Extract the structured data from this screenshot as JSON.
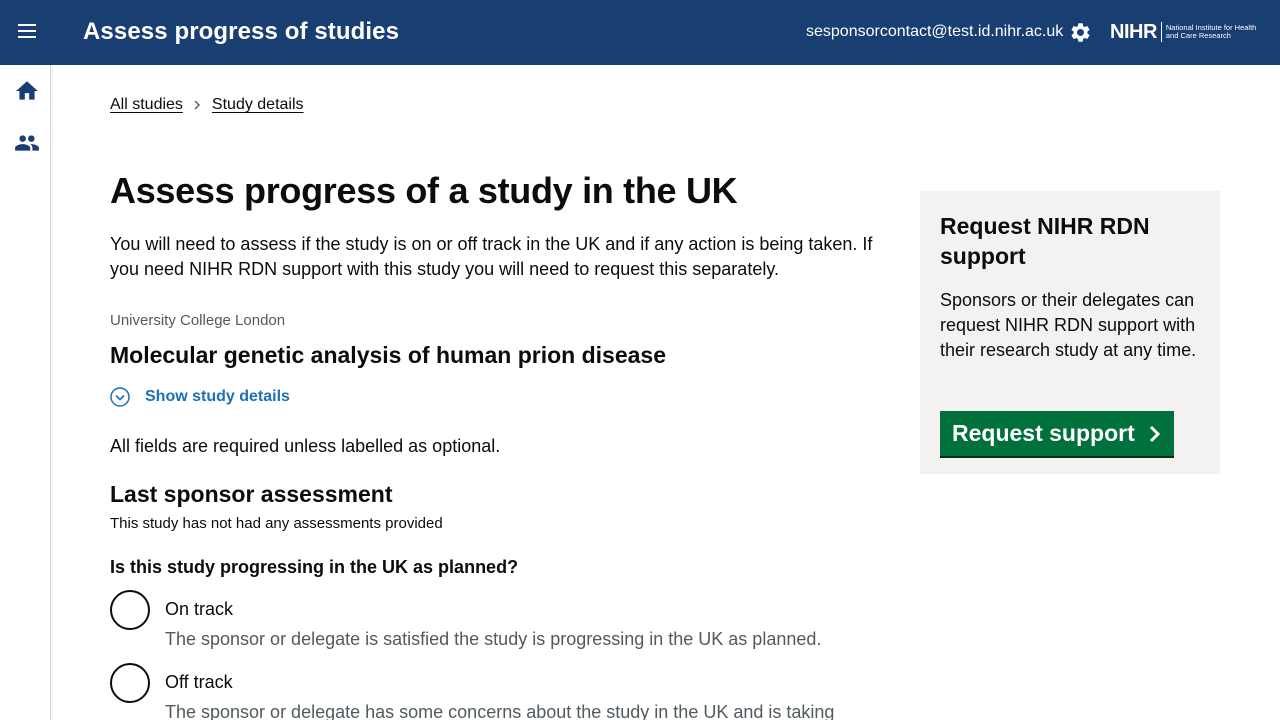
{
  "header": {
    "app_title": "Assess progress of studies",
    "user_email": "sesponsorcontact@test.id.nihr.ac.uk",
    "logo_mark": "NIHR",
    "logo_text": "National Institute for Health and Care Research",
    "menu_icon": "hamburger-icon",
    "settings_icon": "gear-icon",
    "brand_color": "#193e72"
  },
  "sidenav": {
    "items": [
      {
        "icon": "home-icon"
      },
      {
        "icon": "people-icon"
      }
    ]
  },
  "breadcrumb": {
    "items": [
      "All studies",
      "Study details"
    ]
  },
  "main": {
    "title": "Assess progress of a study in the UK",
    "intro": "You will need to assess if the study is on or off track in the UK and if any action is being taken. If you need NIHR RDN support with this study you will need to request this separately.",
    "organisation": "University College London",
    "study_title": "Molecular genetic analysis of human prion disease",
    "show_details_label": "Show study details",
    "required_note": "All fields are required unless labelled as optional.",
    "last_assessment_heading": "Last sponsor assessment",
    "last_assessment_text": "This study has not had any assessments provided",
    "question": "Is this study progressing in the UK as planned?",
    "options": [
      {
        "label": "On track",
        "hint": "The sponsor or delegate is satisfied the study is progressing in the UK as planned."
      },
      {
        "label": "Off track",
        "hint": "The sponsor or delegate has some concerns about the study in the UK and is taking"
      }
    ],
    "link_color": "#1d70b8"
  },
  "aside": {
    "title": "Request NIHR RDN support",
    "text": "Sponsors or their delegates can request NIHR RDN support with their research study at any time.",
    "button_label": "Request support",
    "button_color": "#00703c"
  }
}
